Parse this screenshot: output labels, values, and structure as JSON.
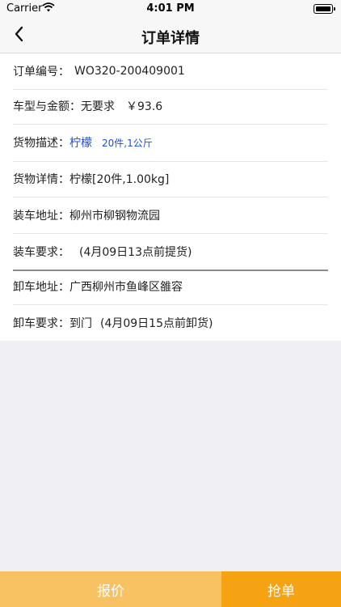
{
  "status_bar": {
    "carrier": "Carrier",
    "time": "4:01 PM"
  },
  "nav": {
    "title": "订单详情"
  },
  "rows": {
    "order_no": {
      "label": "订单编号：",
      "value": "WO320-200409001"
    },
    "vehicle_amount": {
      "label": "车型与金额：",
      "vehicle": "无要求",
      "amount": "￥93.6"
    },
    "goods_desc": {
      "label": "货物描述：",
      "name": "柠檬",
      "qty": "20件,1公斤"
    },
    "goods_detail": {
      "label": "货物详情：",
      "value": "柠檬[20件,1.00kg]"
    },
    "load_address": {
      "label": "装车地址：",
      "value": "柳州市柳钢物流园"
    },
    "load_req": {
      "label": "装车要求：",
      "value": "(4月09日13点前提货)"
    },
    "unload_address": {
      "label": "卸车地址：",
      "value": "广西柳州市鱼峰区雒容"
    },
    "unload_req": {
      "label": "卸车要求：",
      "method": "到门",
      "value": "(4月09日15点前卸货)"
    }
  },
  "buttons": {
    "quote": "报价",
    "grab": "抢单"
  },
  "colors": {
    "quote_bg": "#f8c161",
    "grab_bg": "#f5a213",
    "link_blue": "#1f4fd8"
  },
  "icons": {
    "back": "chevron-left-icon",
    "wifi": "wifi-icon",
    "battery": "battery-icon"
  }
}
